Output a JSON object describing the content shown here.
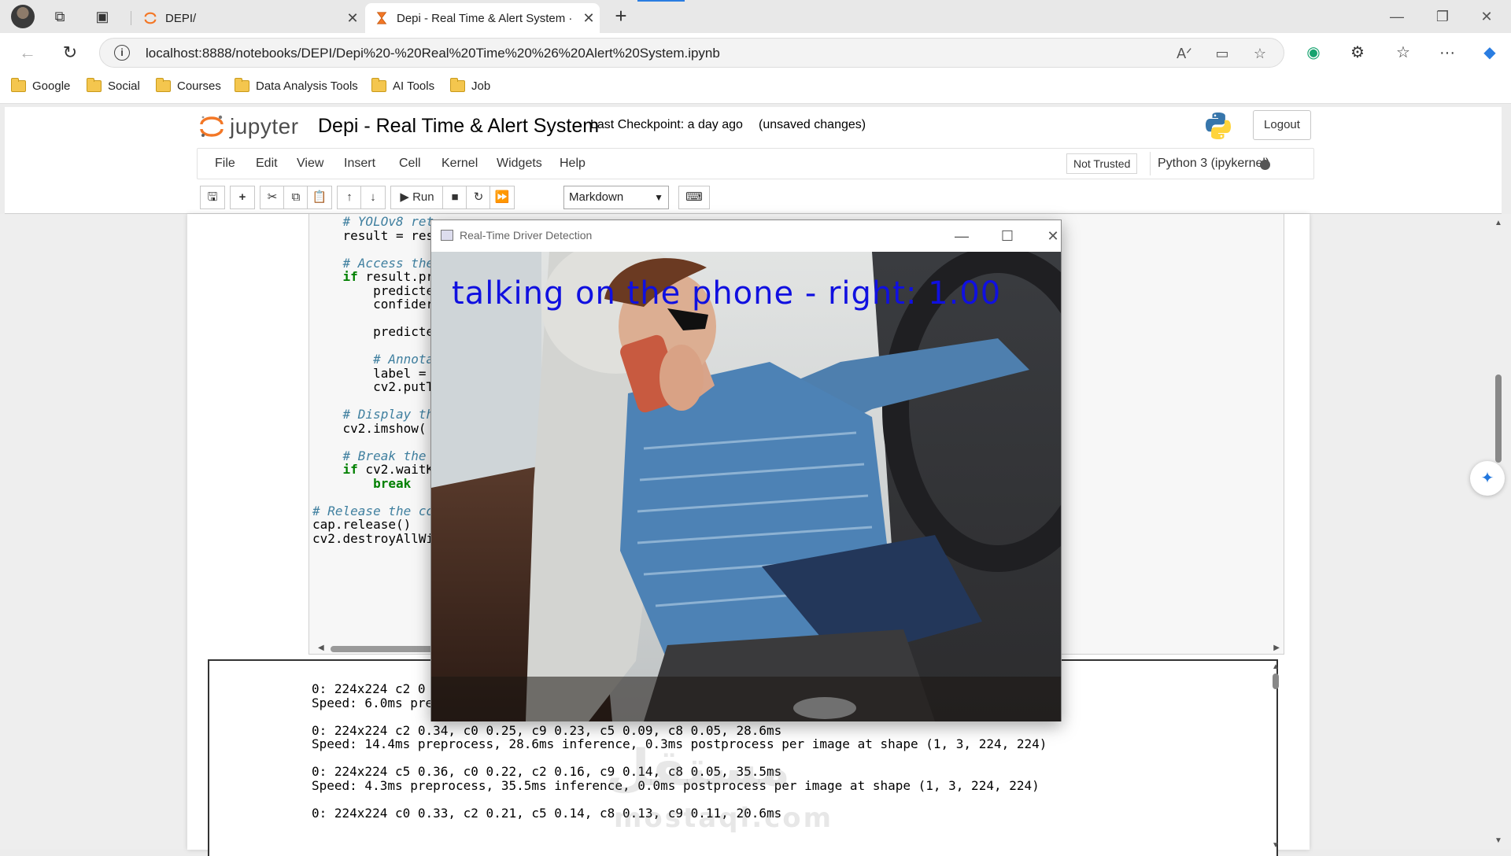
{
  "browser": {
    "tabs": [
      {
        "title": "DEPI/",
        "active": false
      },
      {
        "title": "Depi - Real Time & Alert System ·",
        "active": true
      }
    ],
    "url": "localhost:8888/notebooks/DEPI/Depi%20-%20Real%20Time%20%26%20Alert%20System.ipynb",
    "bookmarks": [
      "Google",
      "Social",
      "Courses",
      "Data Analysis Tools",
      "AI Tools",
      "Job"
    ]
  },
  "jupyter": {
    "logo_text": "jupyter",
    "notebook_title": "Depi - Real Time & Alert System",
    "checkpoint": "Last Checkpoint: a day ago",
    "unsaved": "(unsaved changes)",
    "logout_label": "Logout",
    "menu": [
      "File",
      "Edit",
      "View",
      "Insert",
      "Cell",
      "Kernel",
      "Widgets",
      "Help"
    ],
    "trust_status": "Not Trusted",
    "kernel_name": "Python 3 (ipykernel)",
    "toolbar": {
      "run_label": "Run",
      "cell_type": "Markdown"
    }
  },
  "code_lines": [
    {
      "text": "    # YOLOv8 ret",
      "kind": "comment"
    },
    {
      "text": "    result = res",
      "kind": "code"
    },
    {
      "text": "",
      "kind": "code"
    },
    {
      "text": "    # Access the",
      "kind": "comment"
    },
    {
      "text": "    if result.pr",
      "kind": "keyword-line"
    },
    {
      "text": "        predicte",
      "kind": "code"
    },
    {
      "text": "        confider",
      "kind": "code"
    },
    {
      "text": "",
      "kind": "code"
    },
    {
      "text": "        predicte",
      "kind": "code"
    },
    {
      "text": "",
      "kind": "code"
    },
    {
      "text": "        # Annota",
      "kind": "comment"
    },
    {
      "text": "        label = ",
      "kind": "code"
    },
    {
      "text": "        cv2.putT",
      "kind": "code"
    },
    {
      "text": "",
      "kind": "code"
    },
    {
      "text": "    # Display th",
      "kind": "comment"
    },
    {
      "text": "    cv2.imshow(",
      "kind": "code"
    },
    {
      "text": "",
      "kind": "code"
    },
    {
      "text": "    # Break the ",
      "kind": "comment"
    },
    {
      "text": "    if cv2.waitK",
      "kind": "keyword-line"
    },
    {
      "text": "        break",
      "kind": "keyword"
    },
    {
      "text": "",
      "kind": "code"
    },
    {
      "text": "# Release the co",
      "kind": "comment"
    },
    {
      "text": "cap.release()",
      "kind": "code"
    },
    {
      "text": "cv2.destroyAllWi",
      "kind": "code"
    }
  ],
  "output_lines": [
    "0: 224x224 c2 0",
    "Speed: 6.0ms pre",
    "",
    "0: 224x224 c2 0.34, c0 0.25, c9 0.23, c5 0.09, c8 0.05, 28.6ms",
    "Speed: 14.4ms preprocess, 28.6ms inference, 0.3ms postprocess per image at shape (1, 3, 224, 224)",
    "",
    "0: 224x224 c5 0.36, c0 0.22, c2 0.16, c9 0.14, c8 0.05, 35.5ms",
    "Speed: 4.3ms preprocess, 35.5ms inference, 0.0ms postprocess per image at shape (1, 3, 224, 224)",
    "",
    "0: 224x224 c0 0.33, c2 0.21, c5 0.14, c8 0.13, c9 0.11, 20.6ms"
  ],
  "watermark": {
    "arabic": "مستقل",
    "latin": "mostaql.com"
  },
  "cv_window": {
    "title": "Real-Time Driver Detection",
    "overlay_label": "talking on the phone - right: 1.00",
    "label_color": "#1010e0"
  },
  "colors": {
    "jupyter_orange": "#f37726",
    "comment": "#3f7f9f",
    "keyword": "#008000"
  }
}
